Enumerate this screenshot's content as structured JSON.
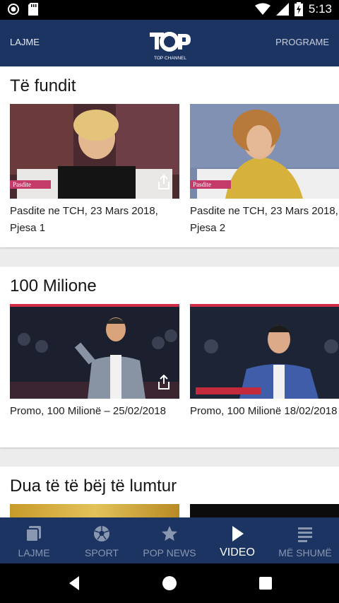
{
  "status_bar": {
    "time": "5:13",
    "icons": [
      "record-icon",
      "sd-card-icon",
      "wifi-icon",
      "signal-icon",
      "battery-charging-icon"
    ]
  },
  "header": {
    "left_label": "LAJME",
    "right_label": "PROGRAME",
    "logo_text": "TOP CHANNEL",
    "colors": {
      "bar": "#1c3461"
    }
  },
  "sections": [
    {
      "title": "Të fundit",
      "cards": [
        {
          "caption": "Pasdite ne TCH, 23 Mars 2018, Pjesa 1",
          "badge": "Pasdite"
        },
        {
          "caption": "Pasdite ne TCH, 23 Mars 2018, Pjesa 2",
          "badge": "Pasdite"
        }
      ]
    },
    {
      "title": "100 Milione",
      "cards": [
        {
          "caption": "Promo, 100 Milionë – 25/02/2018"
        },
        {
          "caption": "Promo, 100 Milionë 18/02/2018"
        }
      ]
    },
    {
      "title": "Dua të të bëj të lumtur",
      "cards": []
    }
  ],
  "bottom_nav": [
    {
      "label": "LAJME",
      "icon": "news-icon",
      "active": false
    },
    {
      "label": "SPORT",
      "icon": "soccer-ball-icon",
      "active": false
    },
    {
      "label": "POP NEWS",
      "icon": "star-icon",
      "active": false
    },
    {
      "label": "VIDEO",
      "icon": "play-icon",
      "active": true
    },
    {
      "label": "MË SHUMË",
      "icon": "menu-lines-icon",
      "active": false
    }
  ],
  "system_nav": [
    "back-icon",
    "home-icon",
    "recents-icon"
  ]
}
